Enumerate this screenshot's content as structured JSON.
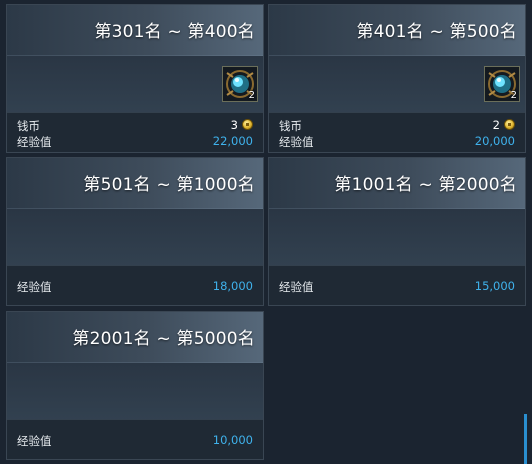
{
  "cards": [
    {
      "title": "第301名 ~ 第400名",
      "item": {
        "icon": "blue-orb-item-icon",
        "count": "2"
      },
      "rows": [
        {
          "label": "钱币",
          "value": "3",
          "coin": true
        },
        {
          "label": "经验值",
          "value": "22,000"
        }
      ]
    },
    {
      "title": "第401名 ~ 第500名",
      "item": {
        "icon": "blue-orb-item-icon",
        "count": "2"
      },
      "rows": [
        {
          "label": "钱币",
          "value": "2",
          "coin": true
        },
        {
          "label": "经验值",
          "value": "20,000"
        }
      ]
    },
    {
      "title": "第501名 ~ 第1000名",
      "rows": [
        {
          "label": "经验值",
          "value": "18,000"
        }
      ]
    },
    {
      "title": "第1001名 ~ 第2000名",
      "rows": [
        {
          "label": "经验值",
          "value": "15,000"
        }
      ]
    },
    {
      "title": "第2001名 ~ 第5000名",
      "rows": [
        {
          "label": "经验值",
          "value": "10,000"
        }
      ]
    }
  ],
  "colors": {
    "accent_value": "#3fb2ec",
    "coin": "#e0b630",
    "scrollbar": "#2a8fd0"
  }
}
